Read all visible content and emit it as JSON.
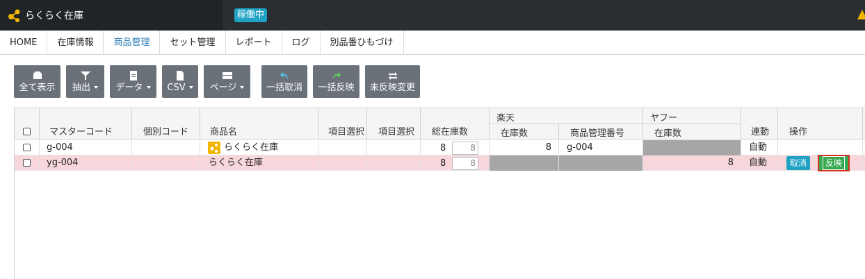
{
  "app": {
    "title": "らくらく在庫",
    "status": "稼働中",
    "accent": "#1fa2c4"
  },
  "nav": [
    {
      "label": "HOME",
      "active": false
    },
    {
      "label": "在庫情報",
      "active": false
    },
    {
      "label": "商品管理",
      "active": true
    },
    {
      "label": "セット管理",
      "active": false
    },
    {
      "label": "レポート",
      "active": false
    },
    {
      "label": "ログ",
      "active": false
    },
    {
      "label": "別品番ひもづけ",
      "active": false
    }
  ],
  "toolbar": {
    "show_all": "全て表示",
    "filter": "抽出",
    "data": "データ",
    "csv": "CSV",
    "page": "ページ",
    "bulk_cancel": "一括取消",
    "bulk_apply": "一括反映",
    "unapplied": "未反映変更"
  },
  "table": {
    "headers": {
      "master_code": "マスターコード",
      "individual_code": "個別コード",
      "product_name": "商品名",
      "item_select_1": "項目選択",
      "item_select_2": "項目選択",
      "total_stock": "総在庫数",
      "rakuten": "楽天",
      "rakuten_stock": "在庫数",
      "rakuten_mgmt_no": "商品管理番号",
      "yahoo": "ヤフー",
      "yahoo_stock": "在庫数",
      "link": "連動",
      "action": "操作"
    },
    "rows": [
      {
        "master_code": "g-004",
        "individual_code": "",
        "product_name": "らくらく在庫",
        "total_stock": "8",
        "total_stock_input": "8",
        "rakuten_stock": "8",
        "rakuten_mgmt_no": "g-004",
        "yahoo_stock": "",
        "link": "自動"
      },
      {
        "master_code": "yg-004",
        "individual_code": "",
        "product_name": "らくらく在庫",
        "total_stock": "8",
        "total_stock_input": "8",
        "rakuten_stock": "",
        "rakuten_mgmt_no": "",
        "yahoo_stock": "8",
        "link": "自動",
        "cancel_label": "取消",
        "apply_label": "反映"
      }
    ]
  }
}
